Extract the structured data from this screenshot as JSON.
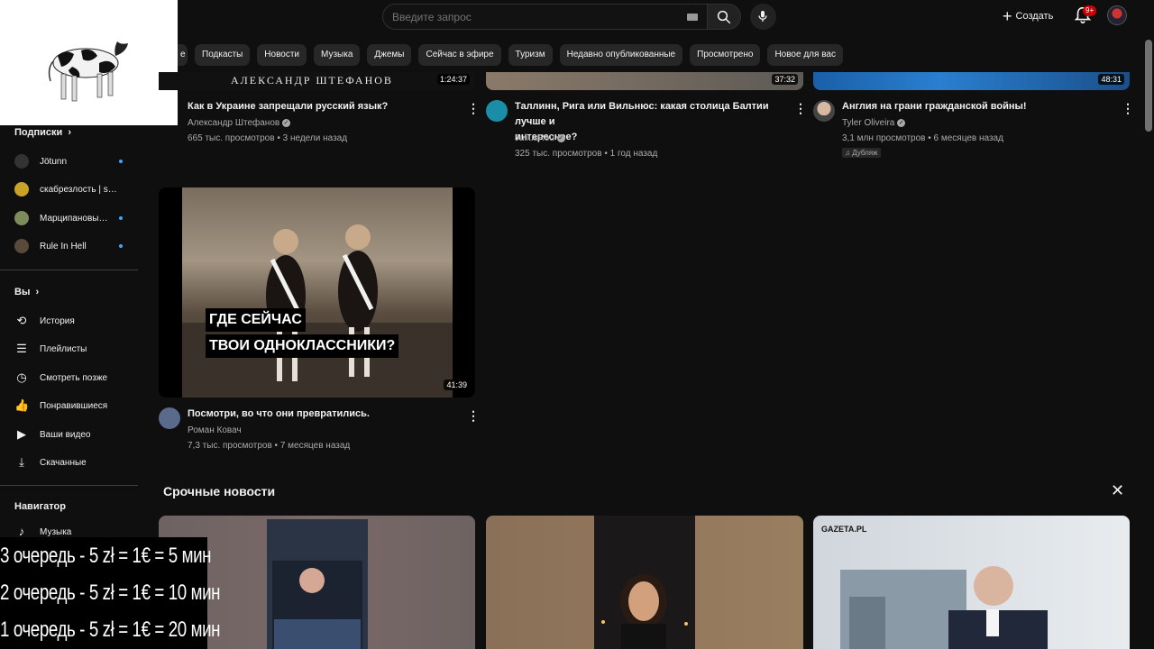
{
  "header": {
    "search_placeholder": "Введите запрос",
    "create_label": "Создать",
    "notifications_badge": "9+"
  },
  "chips": [
    "е",
    "Подкасты",
    "Новости",
    "Музыка",
    "Джемы",
    "Сейчас в эфире",
    "Туризм",
    "Недавно опубликованные",
    "Просмотрено",
    "Новое для вас"
  ],
  "sidebar": {
    "subscriptions_title": "Подписки",
    "subscriptions": [
      {
        "label": "Jötunn",
        "color": "#333333"
      },
      {
        "label": "скабрезлость | ska...",
        "color": "#c9a227"
      },
      {
        "label": "Марципановый ...",
        "color": "#7e8b5a"
      },
      {
        "label": "Rule In Hell",
        "color": "#5a4a3a"
      }
    ],
    "you_title": "Вы",
    "you_items": [
      {
        "label": "История",
        "icon": "history-icon"
      },
      {
        "label": "Плейлисты",
        "icon": "playlists-icon"
      },
      {
        "label": "Смотреть позже",
        "icon": "watch-later-icon"
      },
      {
        "label": "Понравившиеся",
        "icon": "like-icon"
      },
      {
        "label": "Ваши видео",
        "icon": "your-videos-icon"
      },
      {
        "label": "Скачанные",
        "icon": "download-icon"
      }
    ],
    "navigator_title": "Навигатор",
    "navigator_items": [
      {
        "label": "Музыка",
        "icon": "music-icon"
      }
    ]
  },
  "videos_row1": [
    {
      "title": "Как в Украине запрещали русский язык?",
      "channel": "Александр Штефанов",
      "views": "665 тыс. просмотров",
      "age": "3 недели назад",
      "duration": "1:24:37",
      "thumb_text": "АЛЕКСАНДР ШТЕФАНОВ"
    },
    {
      "title_line1": "Таллинн, Рига или Вильнюс: какая столица Балтии лучше и",
      "title_line2": "интереснее?",
      "channel": "JuliusRou",
      "views": "325 тыс. просмотров",
      "age": "1 год назад",
      "duration": "37:32"
    },
    {
      "title": "Англия на грани гражданской войны!",
      "channel": "Tyler Oliveira",
      "views": "3,1 млн просмотров",
      "age": "6 месяцев назад",
      "duration": "48:31",
      "badge": "Дубляж"
    }
  ],
  "video_big": {
    "caption_line1": "ГДЕ СЕЙЧАС",
    "caption_line2": "ТВОИ ОДНОКЛАССНИКИ?",
    "duration": "41:39",
    "title": "Посмотри, во что они превратились.",
    "channel": "Роман Ковач",
    "views": "7,3 тыс. просмотров",
    "age": "7 месяцев назад"
  },
  "breaking_news": {
    "title": "Срочные новости",
    "card3_logo": "GAZETA.PL"
  },
  "overlay": {
    "line1": "3 очередь - 5 zł = 1€ = 5 мин",
    "line2": "2 очередь - 5 zł = 1€ = 10 мин",
    "line3": "1 очередь - 5 zł = 1€ = 20 мин"
  },
  "colors": {
    "background": "#0f0f0f",
    "chip": "#272727",
    "accent_blue": "#3ea6ff",
    "badge_red": "#cc0000"
  }
}
